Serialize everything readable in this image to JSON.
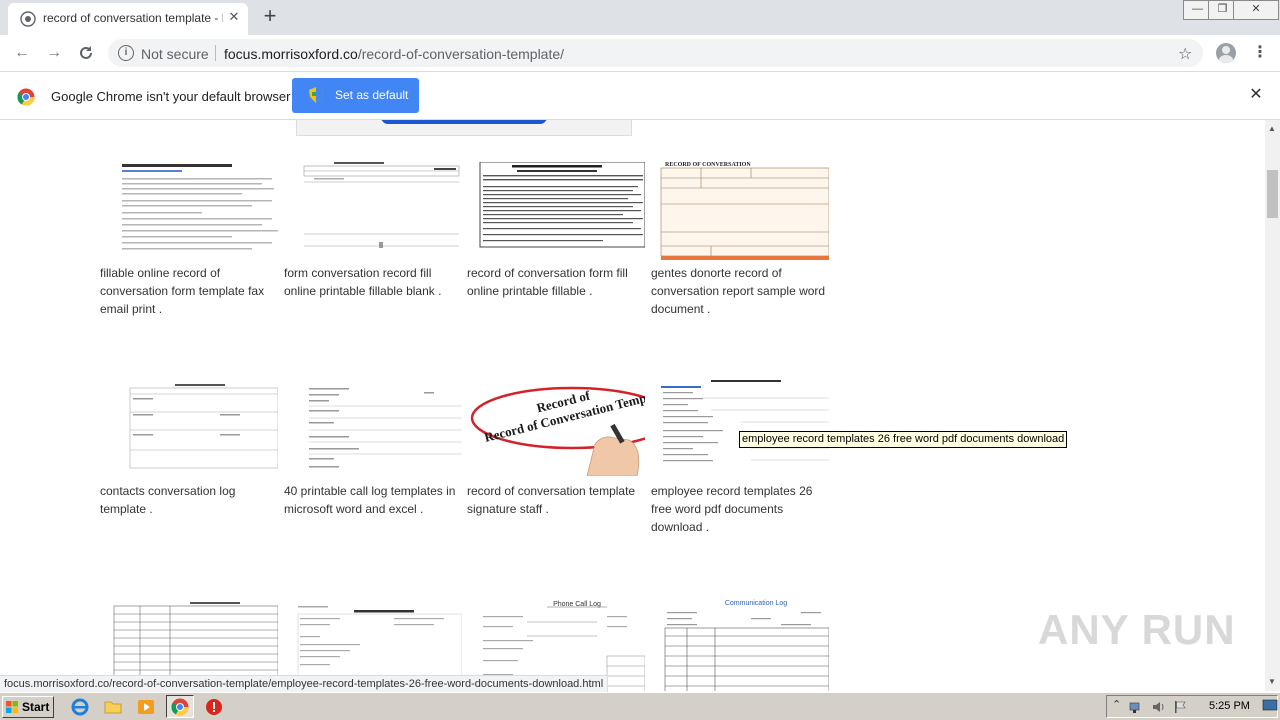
{
  "browser": {
    "tab_title": "record of conversation template - Fo",
    "new_tab": "+",
    "window_controls": {
      "minimize": "—",
      "restore": "❐",
      "close": "✕"
    },
    "security_text": "Not secure",
    "url_host": "focus.morrisoxford.co",
    "url_path": "/record-of-conversation-template/"
  },
  "infobar": {
    "message": "Google Chrome isn't your default browser",
    "button_label": "Set as default"
  },
  "gallery": [
    {
      "caption": "fillable online record of conversation form template fax email print ."
    },
    {
      "caption": "form conversation record fill online printable fillable blank ."
    },
    {
      "caption": "record of conversation form fill online printable fillable ."
    },
    {
      "caption": "gentes donorte record of conversation report sample word document ."
    },
    {
      "caption": "contacts conversation log template ."
    },
    {
      "caption": "40 printable call log templates in microsoft word and excel ."
    },
    {
      "caption": "record of conversation template signature staff ."
    },
    {
      "caption": "employee record templates 26 free word pdf documents download ."
    }
  ],
  "thumb_texts": {
    "t4_header": "RECORD OF CONVERSATION",
    "t7_title": "Record of Conversation Templ",
    "t11_title": "Phone Call Log",
    "t12_title": "Communication Log"
  },
  "tooltip": "employee record templates 26 free word pdf documents download",
  "status_url": "focus.morrisoxford.co/record-of-conversation-template/employee-record-templates-26-free-word-documents-download.html",
  "watermark": "ANY RUN",
  "taskbar": {
    "start_label": "Start",
    "clock": "5:25 PM"
  }
}
